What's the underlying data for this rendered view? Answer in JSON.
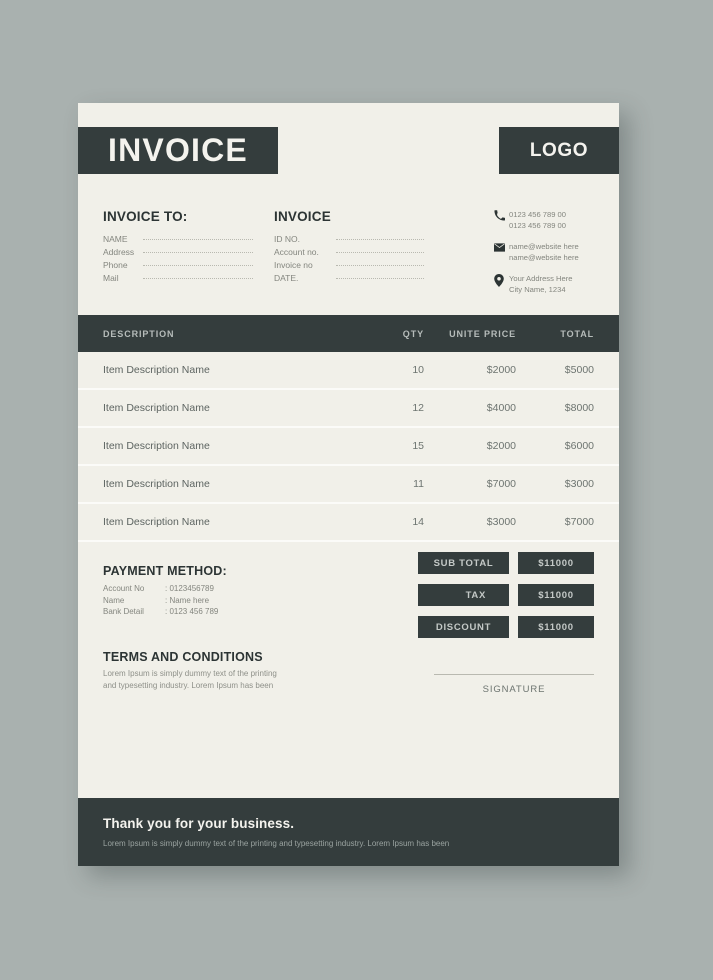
{
  "document": {
    "title": "INVOICE",
    "logo": "LOGO"
  },
  "colors": {
    "dark": "#343d3d",
    "paper": "#f1f0e9",
    "backdrop": "#a9b1af",
    "muted_text": "#84867f"
  },
  "bill_to": {
    "heading": "INVOICE TO:",
    "fields": [
      {
        "label": "NAME"
      },
      {
        "label": "Address"
      },
      {
        "label": "Phone"
      },
      {
        "label": "Mail"
      }
    ]
  },
  "invoice_meta": {
    "heading": "INVOICE",
    "fields": [
      {
        "label": "ID NO."
      },
      {
        "label": "Account no."
      },
      {
        "label": "Invoice no"
      },
      {
        "label": "DATE."
      }
    ]
  },
  "contact": {
    "phone": {
      "icon": "phone-icon",
      "line1": "0123 456 789 00",
      "line2": "0123 456 789 00"
    },
    "email": {
      "icon": "envelope-icon",
      "line1": "name@website  here",
      "line2": "name@website  here"
    },
    "address": {
      "icon": "location-pin-icon",
      "line1": "Your Address Here",
      "line2": "City Name, 1234"
    }
  },
  "table": {
    "columns": [
      "DESCRIPTION",
      "QTY",
      "UNITE PRICE",
      "TOTAL"
    ],
    "rows": [
      {
        "description": "Item Description Name",
        "qty": "10",
        "unit_price": "$2000",
        "total": "$5000"
      },
      {
        "description": "Item Description Name",
        "qty": "12",
        "unit_price": "$4000",
        "total": "$8000"
      },
      {
        "description": "Item Description Name",
        "qty": "15",
        "unit_price": "$2000",
        "total": "$6000"
      },
      {
        "description": "Item Description Name",
        "qty": "11",
        "unit_price": "$7000",
        "total": "$3000"
      },
      {
        "description": "Item Description Name",
        "qty": "14",
        "unit_price": "$3000",
        "total": "$7000"
      }
    ]
  },
  "payment_method": {
    "heading": "PAYMENT METHOD:",
    "rows": [
      {
        "key": "Account No",
        "value": ": 0123456789"
      },
      {
        "key": "Name",
        "value": ": Name here"
      },
      {
        "key": "Bank Detail",
        "value": ": 0123 456 789"
      }
    ]
  },
  "terms": {
    "heading": "TERMS AND CONDITIONS",
    "body": "Lorem Ipsum is simply dummy text of the printing and typesetting industry. Lorem Ipsum has been"
  },
  "totals": [
    {
      "label": "SUB TOTAL",
      "value": "$11000",
      "align": "center"
    },
    {
      "label": "TAX",
      "value": "$11000",
      "align": "right"
    },
    {
      "label": "DISCOUNT",
      "value": "$11000",
      "align": "center"
    }
  ],
  "signature": {
    "label": "SIGNATURE"
  },
  "footer": {
    "title": "Thank you for your business.",
    "subtitle": "Lorem Ipsum is simply dummy text of the printing and typesetting industry. Lorem Ipsum has been"
  }
}
